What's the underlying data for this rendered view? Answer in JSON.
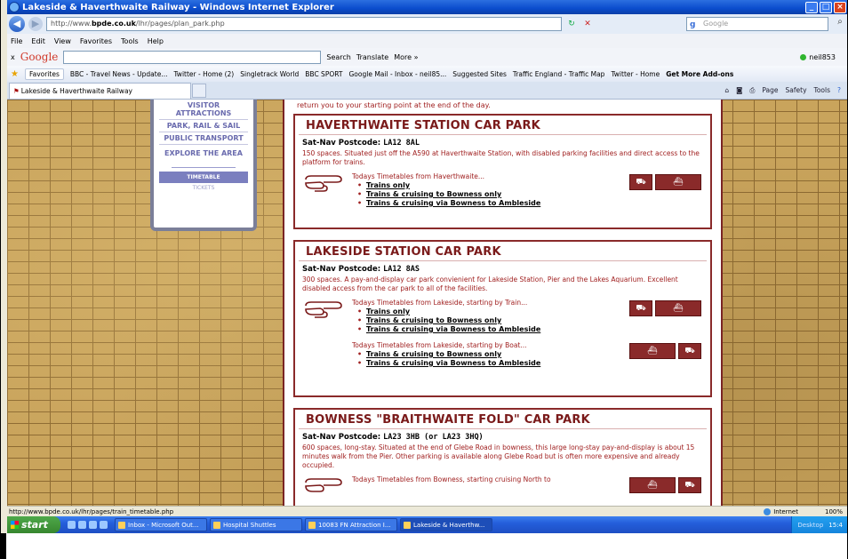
{
  "window": {
    "title": "Lakeside & Haverthwaite Railway - Windows Internet Explorer"
  },
  "address": {
    "prefix": "http://www.",
    "domain": "bpde.co.uk",
    "path": "/lhr/pages/plan_park.php",
    "search_placeholder": "Google"
  },
  "menu": [
    "File",
    "Edit",
    "View",
    "Favorites",
    "Tools",
    "Help"
  ],
  "google_toolbar": {
    "label": "Google",
    "search": "Search",
    "translate": "Translate",
    "more": "More »",
    "user": "neil853"
  },
  "favorites": {
    "label": "Favorites",
    "items": [
      "BBC - Travel News - Update...",
      "Twitter - Home (2)",
      "Singletrack World",
      "BBC SPORT",
      "Google Mail - Inbox - neil85...",
      "Suggested Sites",
      "Traffic England - Traffic Map",
      "Twitter - Home",
      "Get More Add-ons"
    ]
  },
  "tab": {
    "title": "Lakeside & Haverthwaite Railway"
  },
  "commandbar": [
    "Page",
    "Safety",
    "Tools"
  ],
  "sidenav": {
    "items": [
      "VISITOR ATTRACTIONS",
      "PARK, RAIL & SAIL",
      "PUBLIC TRANSPORT",
      "EXPLORE THE AREA"
    ],
    "timetable": "TIMETABLE",
    "tickets": "TICKETS"
  },
  "page": {
    "topline": "return you to your starting point at the end of the day.",
    "sections": [
      {
        "title": "HAVERTHWAITE STATION CAR PARK",
        "satnav_label": "Sat-Nav Postcode:",
        "postcode": "LA12 8AL",
        "desc": "150 spaces. Situated just off the A590 at Haverthwaite Station, with disabled parking facilities and direct access to the platform for trains.",
        "timetables": [
          {
            "intro": "Todays Timetables from Haverthwaite...",
            "links": [
              "Trains only",
              "Trains & cruising to Bowness only",
              "Trains & cruising via Bowness to Ambleside"
            ]
          }
        ]
      },
      {
        "title": "LAKESIDE STATION CAR PARK",
        "satnav_label": "Sat-Nav Postcode:",
        "postcode": "LA12 8AS",
        "desc": "300 spaces. A pay-and-display car park convienient for Lakeside Station, Pier and the Lakes Aquarium. Excellent disabled access from the car park to all of the facilities.",
        "timetables": [
          {
            "intro": "Todays Timetables from Lakeside, starting by Train...",
            "links": [
              "Trains only",
              "Trains & cruising to Bowness only",
              "Trains & cruising via Bowness to Ambleside"
            ]
          },
          {
            "intro": "Todays Timetables from Lakeside, starting by Boat...",
            "links": [
              "Trains & cruising to Bowness only",
              "Trains & cruising via Bowness to Ambleside"
            ]
          }
        ]
      },
      {
        "title": "BOWNESS \"BRAITHWAITE FOLD\" CAR PARK",
        "satnav_label": "Sat-Nav Postcode:",
        "postcode": "LA23 3HB (or LA23 3HQ)",
        "desc": "600 spaces, long-stay. Situated at the end of Glebe Road in bowness, this large long-stay pay-and-display is about 15 minutes walk from the Pier. Other parking is available along Glebe Road but is often more expensive and already occupied.",
        "timetables": [
          {
            "intro": "Todays Timetables from Bowness, starting cruising North to",
            "links": []
          }
        ]
      }
    ]
  },
  "status": {
    "url": "http://www.bpde.co.uk/lhr/pages/train_timetable.php",
    "zone": "Internet",
    "zoom": "100%"
  },
  "taskbar": {
    "start": "start",
    "tasks": [
      "Inbox - Microsoft Out...",
      "Hospital Shuttles",
      "10083 FN Attraction I...",
      "Lakeside & Haverthw..."
    ],
    "tray": {
      "desktop": "Desktop",
      "time": "15:4"
    }
  }
}
